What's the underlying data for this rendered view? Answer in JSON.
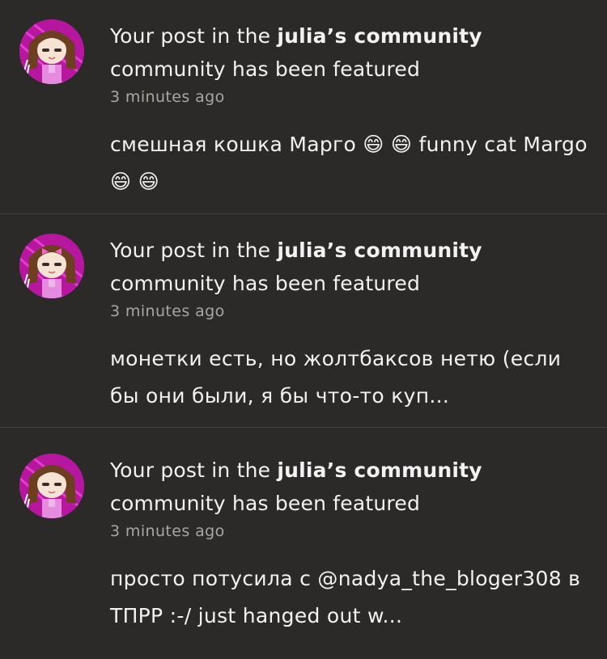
{
  "notifications": [
    {
      "prefix": "Your post in the ",
      "community_name": "julia’s community",
      "suffix": "community has been featured",
      "time": "3 minutes ago",
      "snippet": "смешная кошка Марго 😄 😄  funny cat Margo 😄 😄"
    },
    {
      "prefix": "Your post in the ",
      "community_name": "julia’s community",
      "suffix": "community has been featured",
      "time": "3 minutes ago",
      "snippet": "монетки есть, но жолтбаксов нетю (если бы они были, я бы что-то куп..."
    },
    {
      "prefix": "Your post in the ",
      "community_name": "julia’s community",
      "suffix": "community has been featured",
      "time": "3 minutes ago",
      "snippet": "просто потусила с @nadya_the_bloger308 в ТПРР :-/ just hanged out w..."
    }
  ],
  "colors": {
    "background": "#2b2a28",
    "text": "#f2f2f2",
    "muted": "#a7a6a3",
    "divider": "#444341",
    "avatar_bg": "#b6179e"
  }
}
